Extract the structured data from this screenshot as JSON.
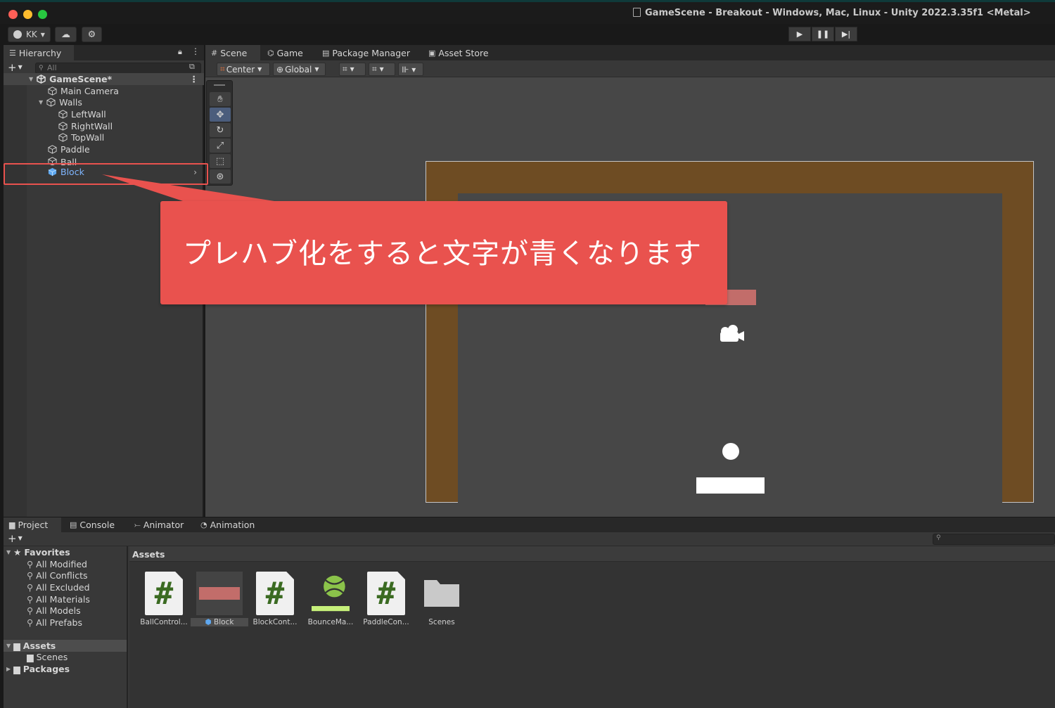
{
  "window": {
    "title": "GameScene - Breakout - Windows, Mac, Linux - Unity 2022.3.35f1 <Metal>"
  },
  "toolbar": {
    "account_label": "KK",
    "play_icon": "play-icon",
    "pause_icon": "pause-icon",
    "step_icon": "step-icon"
  },
  "hierarchy": {
    "tab_label": "Hierarchy",
    "search_placeholder": "All",
    "root": "GameScene*",
    "items": [
      {
        "label": "Main Camera",
        "indent": 1
      },
      {
        "label": "Walls",
        "indent": 1
      },
      {
        "label": "LeftWall",
        "indent": 2
      },
      {
        "label": "RightWall",
        "indent": 2
      },
      {
        "label": "TopWall",
        "indent": 2
      },
      {
        "label": "Paddle",
        "indent": 1
      },
      {
        "label": "Ball",
        "indent": 1
      },
      {
        "label": "Block",
        "indent": 1
      }
    ]
  },
  "scene_tabs": [
    {
      "label": "Scene",
      "icon": "grid-icon"
    },
    {
      "label": "Game",
      "icon": "gamepad-icon"
    },
    {
      "label": "Package Manager",
      "icon": "package-icon"
    },
    {
      "label": "Asset Store",
      "icon": "store-icon"
    }
  ],
  "scene_tools": {
    "pivot": "Center",
    "space": "Global"
  },
  "callout": {
    "text": "プレハブ化をすると文字が青くなります"
  },
  "bottom_tabs": [
    {
      "label": "Project",
      "icon": "folder-icon"
    },
    {
      "label": "Console",
      "icon": "console-icon"
    },
    {
      "label": "Animator",
      "icon": "animator-icon"
    },
    {
      "label": "Animation",
      "icon": "animation-icon"
    }
  ],
  "project_tree": {
    "favorites_label": "Favorites",
    "favorites": [
      "All Modified",
      "All Conflicts",
      "All Excluded",
      "All Materials",
      "All Models",
      "All Prefabs"
    ],
    "assets_label": "Assets",
    "assets_children": [
      "Scenes"
    ],
    "packages_label": "Packages"
  },
  "assets": {
    "header": "Assets",
    "items": [
      {
        "label": "BallControl...",
        "type": "script"
      },
      {
        "label": "Block",
        "type": "prefab"
      },
      {
        "label": "BlockCont...",
        "type": "script"
      },
      {
        "label": "BounceMa...",
        "type": "physics-material"
      },
      {
        "label": "PaddleCon...",
        "type": "script"
      },
      {
        "label": "Scenes",
        "type": "folder"
      }
    ]
  },
  "colors": {
    "wall": "#6e4c23",
    "block": "#c26d6a",
    "callout": "#e9524e",
    "prefab_text": "#7fb6ff"
  }
}
